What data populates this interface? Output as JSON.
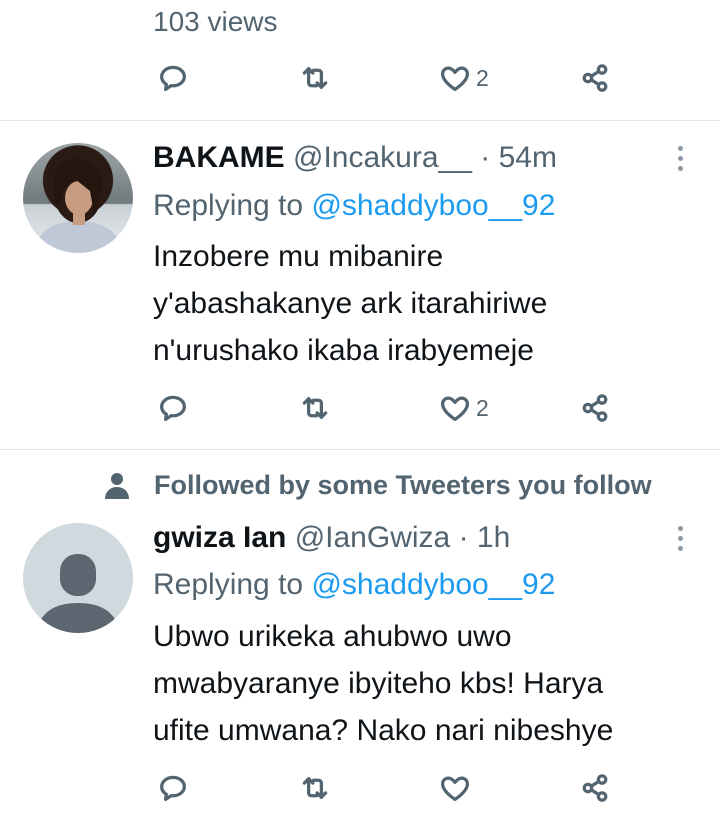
{
  "top": {
    "views": "103 views",
    "actions": {
      "like_count": "2"
    }
  },
  "tweets": [
    {
      "name": "BAKAME",
      "handle": "@Incakura__",
      "dot": "·",
      "time": "54m",
      "replying_label": "Replying to",
      "replying_to": "@shaddyboo__92",
      "text_lines": [
        "Inzobere mu mibanire",
        "y'abashakanye ark itarahiriwe",
        "n'urushako ikaba irabyemeje"
      ],
      "like_count": "2"
    },
    {
      "social_context": "Followed by some Tweeters you follow",
      "name": "gwiza Ian",
      "handle": "@IanGwiza",
      "dot": "·",
      "time": "1h",
      "replying_label": "Replying to",
      "replying_to": "@shaddyboo__92",
      "text_lines": [
        "Ubwo urikeka ahubwo uwo",
        "mwabyaranye ibyiteho kbs! Harya",
        "ufite umwana? Nako nari nibeshye"
      ],
      "like_count": ""
    }
  ],
  "icons": {
    "reply": "reply-icon",
    "retweet": "retweet-icon",
    "like": "heart-icon",
    "share": "share-icon",
    "more": "more-vertical-icon",
    "person": "person-icon"
  },
  "colors": {
    "link": "#1d9bf0",
    "muted": "#536471",
    "text": "#0f1419",
    "divider": "#e4e8eb",
    "default_avatar_bg": "#cfd9de",
    "default_avatar_fg": "#5b6670"
  }
}
